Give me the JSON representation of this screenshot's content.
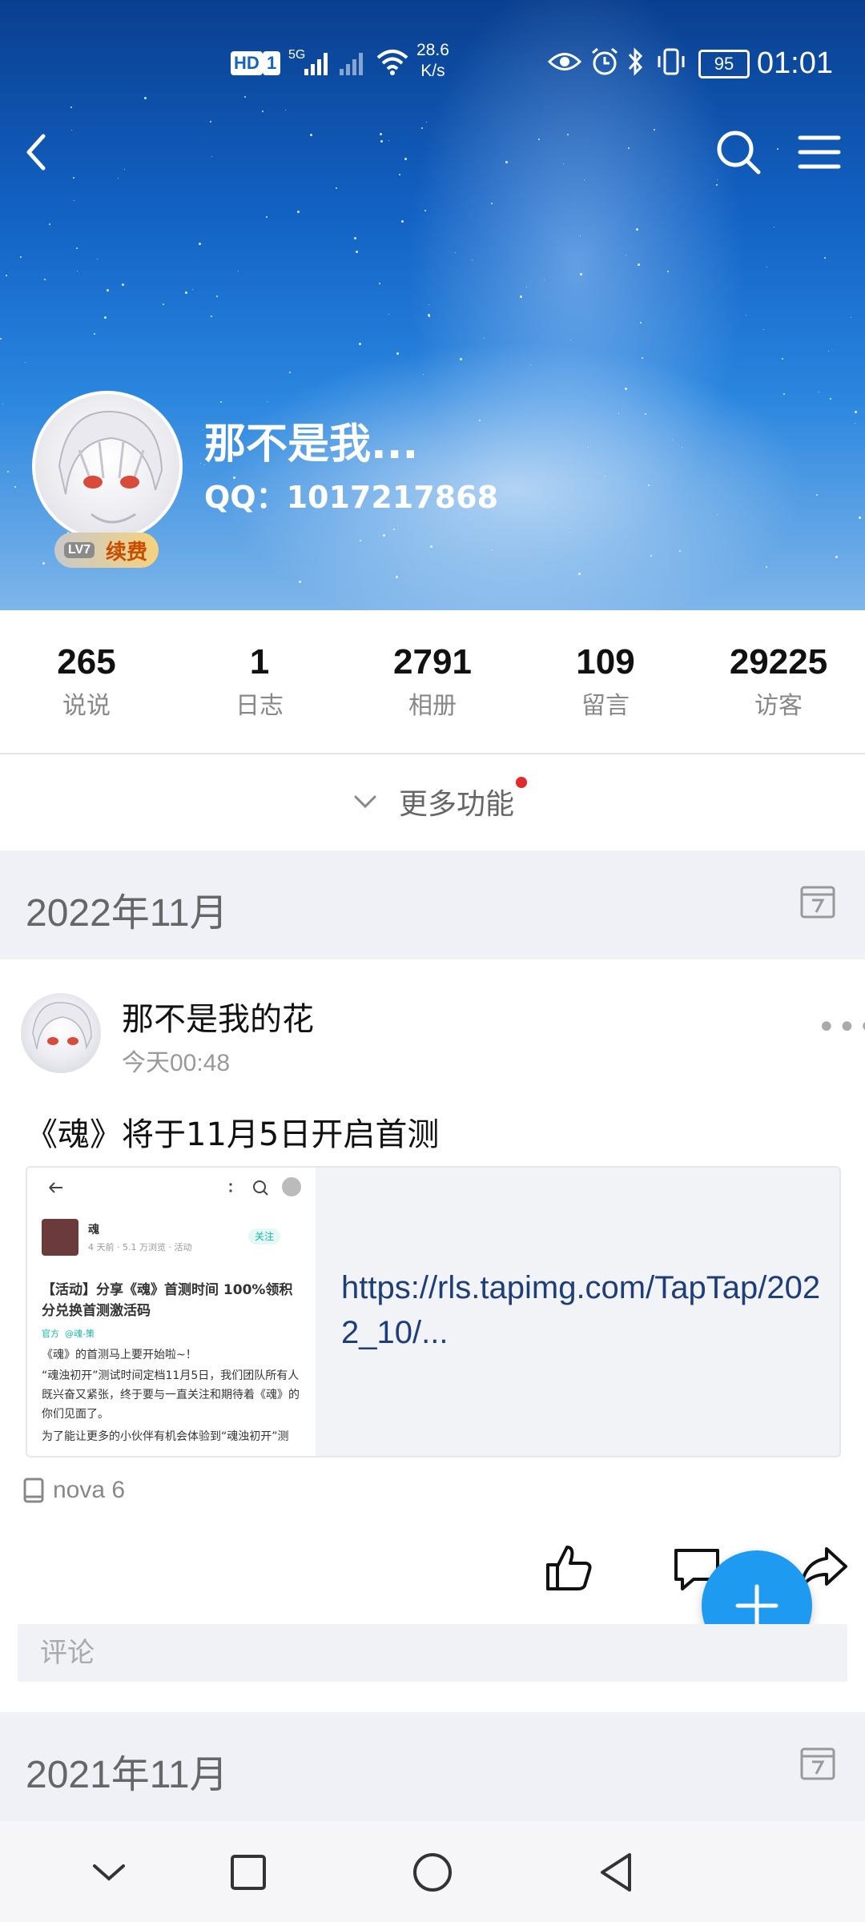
{
  "status_bar": {
    "hd_label": "HD",
    "sim_label": "1",
    "network": "5G",
    "speed_value": "28.6",
    "speed_unit": "K/s",
    "battery": "95",
    "time": "01:01"
  },
  "header": {
    "back_icon": "back-arrow-icon",
    "search_icon": "search-icon",
    "menu_icon": "menu-icon"
  },
  "profile": {
    "name": "那不是我...",
    "qq": "QQ：1017217868",
    "level_badge": "LV7",
    "renew_label": "续费"
  },
  "stats": [
    {
      "value": "265",
      "label": "说说"
    },
    {
      "value": "1",
      "label": "日志"
    },
    {
      "value": "2791",
      "label": "相册"
    },
    {
      "value": "109",
      "label": "留言"
    },
    {
      "value": "29225",
      "label": "访客"
    }
  ],
  "more_functions": {
    "label": "更多功能"
  },
  "months": [
    {
      "label": "2022年11月"
    },
    {
      "label": "2021年11月"
    }
  ],
  "post": {
    "author": "那不是我的花",
    "time": "今天00:48",
    "text": "《魂》将于11月5日开启首测",
    "link_url": "https://rls.tapimg.com/TapTap/2022_10/...",
    "thumbnail": {
      "app_name": "魂",
      "meta": "4 天前 · 5.1 万浏览 · 活动",
      "follow": "关注",
      "title": "【活动】分享《魂》首测时间 100%领积分兑换首测激活码",
      "tag1": "官方",
      "tag2": "@魂-策",
      "line1": "《魂》的首测马上要开始啦~！",
      "line2": "“魂浊初开”测试时间定档11月5日，我们团队所有人既兴奋又紧张，终于要与一直关注和期待着《魂》的你们见面了。",
      "line3": "为了能让更多的小伙伴有机会体验到“魂浊初开”测"
    },
    "device": "nova 6",
    "comment_placeholder": "评论"
  },
  "colors": {
    "accent": "#1e9bf0",
    "link": "#1d3e7a",
    "month_bg": "#eff1f6"
  }
}
